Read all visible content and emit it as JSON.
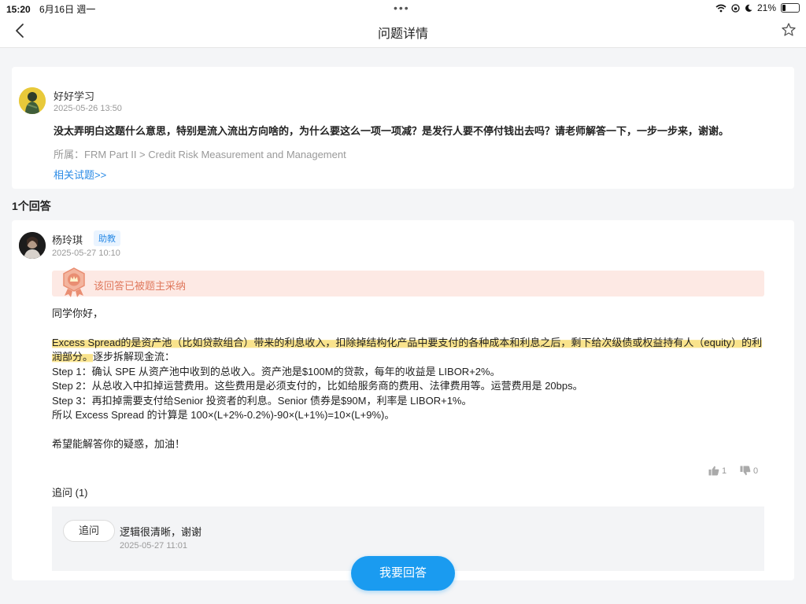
{
  "status_bar": {
    "time": "15:20",
    "date": "6月16日 週一",
    "battery": "21%",
    "battery_fraction": 0.21
  },
  "nav": {
    "title": "问题详情"
  },
  "question": {
    "user": "好好学习",
    "time": "2025-05-26 13:50",
    "text": "没太弄明白这题什么意思，特别是流入流出方向啥的，为什么要这么一项一项减？是发行人要不停付钱出去吗？请老师解答一下，一步一步来，谢谢。",
    "category": "所属：FRM Part II > Credit Risk Measurement and Management",
    "related_link": "相关试题>>"
  },
  "answers_count": "1个回答",
  "answer": {
    "user": "杨玲琪",
    "role": "助教",
    "time": "2025-05-27 10:10",
    "accepted": "该回答已被题主采纳",
    "greeting": "同学你好，",
    "highlight": "Excess Spread的是资产池（比如贷款组合）带来的利息收入，扣除掉结构化产品中要支付的各种成本和利息之后，剩下给次级债或权益持有人（equity）的利润部分。",
    "after_highlight": "逐步拆解现金流：",
    "step1": "Step 1：确认 SPE 从资产池中收到的总收入。资产池是$100M的贷款，每年的收益是 LIBOR+2%。",
    "step2": "Step 2：从总收入中扣掉运营费用。这些费用是必须支付的，比如给服务商的费用、法律费用等。运营费用是 20bps。",
    "step3": "Step 3：再扣掉需要支付给Senior 投资者的利息。Senior 债券是$90M，利率是 LIBOR+1%。",
    "formula": "所以 Excess Spread 的计算是 100×(L+2%-0.2%)-90×(L+1%)=10×(L+9%)。",
    "closing": "希望能解答你的疑惑，加油！",
    "likes": "1",
    "dislikes": "0"
  },
  "followup": {
    "label": "追问 (1)",
    "tag": "追问",
    "text": "逻辑很清晰，谢谢",
    "time": "2025-05-27 11:01"
  },
  "answer_button": "我要回答",
  "colors": {
    "accent": "#1a9bf0",
    "link": "#2b8be6",
    "accepted_bg": "#fde9e4",
    "accepted_text": "#e07a5f",
    "highlight": "#f8de78"
  }
}
